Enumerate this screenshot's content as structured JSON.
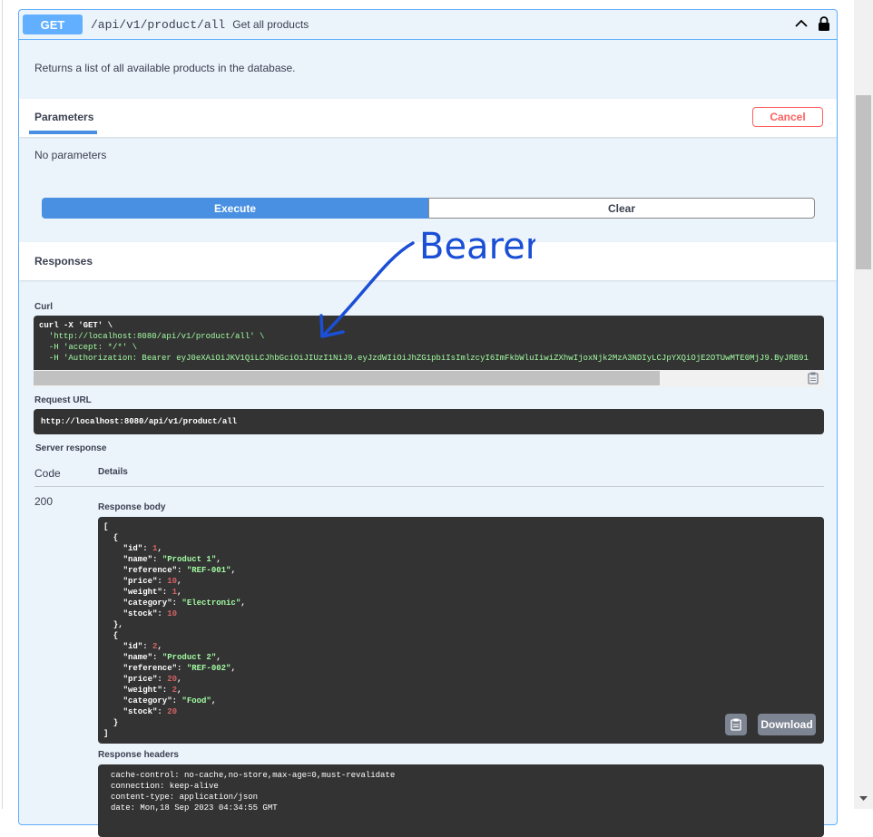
{
  "summary": {
    "method": "GET",
    "path": "/api/v1/product/all",
    "description": "Get all products"
  },
  "description": "Returns a list of all available products in the database.",
  "parameters": {
    "tab_label": "Parameters",
    "cancel_label": "Cancel",
    "no_params": "No parameters"
  },
  "buttons": {
    "execute": "Execute",
    "clear": "Clear"
  },
  "responses": {
    "title": "Responses",
    "curl_label": "Curl",
    "curl_lines": [
      "curl -X 'GET' \\",
      "  'http://localhost:8080/api/v1/product/all' \\",
      "  -H 'accept: */*' \\",
      "  -H 'Authorization: Bearer eyJ0eXAiOiJKV1QiLCJhbGciOiJIUzI1NiJ9.eyJzdWIiOiJhZG1pbiIsImlzcyI6ImFkbWluIiwiZXhwIjoxNjk2MzA3NDIyLCJpYXQiOjE2OTUwMTE0MjJ9.ByJRB91"
    ],
    "request_url_label": "Request URL",
    "request_url": "http://localhost:8080/api/v1/product/all",
    "server_response_label": "Server response",
    "col_code": "Code",
    "col_details": "Details",
    "status_code": "200",
    "response_body_label": "Response body",
    "download_label": "Download",
    "response_headers_label": "Response headers",
    "response_headers": [
      "cache-control: no-cache,no-store,max-age=0,must-revalidate",
      "connection: keep-alive",
      "content-type: application/json",
      "date: Mon,18 Sep 2023 04:34:55 GMT"
    ]
  },
  "products": [
    {
      "id": 1,
      "name": "Product 1",
      "reference": "REF-001",
      "price": 10,
      "weight": 1,
      "category": "Electronic",
      "stock": 10
    },
    {
      "id": 2,
      "name": "Product 2",
      "reference": "REF-002",
      "price": 20,
      "weight": 2,
      "category": "Food",
      "stock": 20
    }
  ],
  "annotation": {
    "text": "Bearer",
    "color": "#1a4fd6"
  },
  "colors": {
    "get_method": "#61affe",
    "execute": "#4990e2",
    "cancel": "#ff6060",
    "code_bg": "#333333"
  }
}
